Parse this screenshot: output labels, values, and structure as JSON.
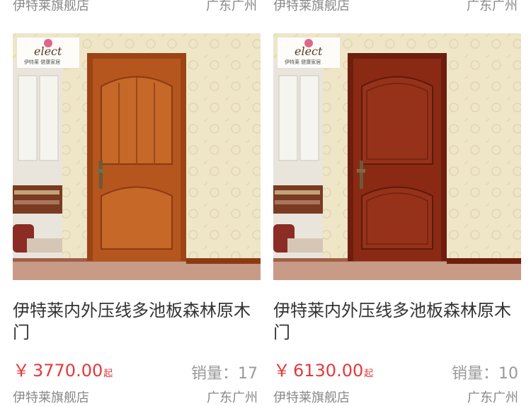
{
  "top_row": [
    {
      "shop": "伊特莱旗舰店",
      "location": "广东广州"
    },
    {
      "shop": "伊特莱旗舰店",
      "location": "广东广州"
    }
  ],
  "products": [
    {
      "logo_text": "elect",
      "logo_tagline": "伊特莱 健康家居",
      "title": "伊特莱内外压线多池板森林原木门",
      "currency": "￥",
      "price": "3770.00",
      "price_suffix": "起",
      "sales_label": "销量：",
      "sales_count": "17",
      "shop": "伊特莱旗舰店",
      "location": "广东广州",
      "door_color": "#b5561e"
    },
    {
      "logo_text": "elect",
      "logo_tagline": "伊特莱 健康家居",
      "title": "伊特莱内外压线多池板森林原木门",
      "currency": "￥",
      "price": "6130.00",
      "price_suffix": "起",
      "sales_label": "销量：",
      "sales_count": "10",
      "shop": "伊特莱旗舰店",
      "location": "广东广州",
      "door_color": "#8a2a14"
    }
  ],
  "colors": {
    "price": "#e4393c",
    "muted": "#888888",
    "wall": "#efe6c8"
  }
}
